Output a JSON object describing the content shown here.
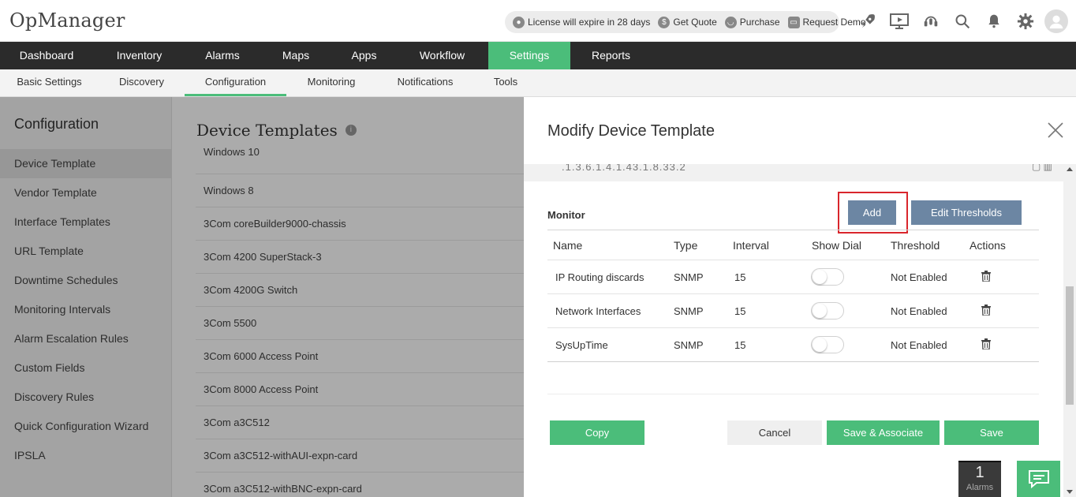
{
  "app": {
    "title": "OpManager"
  },
  "header": {
    "license_text": "License will expire in 28 days",
    "get_quote": "Get Quote",
    "purchase": "Purchase",
    "request_demo": "Request Demo",
    "icons": [
      "rocket-icon",
      "presentation-icon",
      "support-headset-icon",
      "search-icon",
      "bell-icon",
      "gear-icon",
      "user-avatar-icon"
    ]
  },
  "mainnav": {
    "items": [
      {
        "label": "Dashboard"
      },
      {
        "label": "Inventory"
      },
      {
        "label": "Alarms"
      },
      {
        "label": "Maps"
      },
      {
        "label": "Apps"
      },
      {
        "label": "Workflow"
      },
      {
        "label": "Settings"
      },
      {
        "label": "Reports"
      }
    ],
    "active": "Settings"
  },
  "subnav": {
    "items": [
      {
        "label": "Basic Settings"
      },
      {
        "label": "Discovery"
      },
      {
        "label": "Configuration"
      },
      {
        "label": "Monitoring"
      },
      {
        "label": "Notifications"
      },
      {
        "label": "Tools"
      }
    ],
    "active": "Configuration"
  },
  "sidebar": {
    "title": "Configuration",
    "items": [
      {
        "label": "Device Template"
      },
      {
        "label": "Vendor Template"
      },
      {
        "label": "Interface Templates"
      },
      {
        "label": "URL Template"
      },
      {
        "label": "Downtime Schedules"
      },
      {
        "label": "Monitoring Intervals"
      },
      {
        "label": "Alarm Escalation Rules"
      },
      {
        "label": "Custom Fields"
      },
      {
        "label": "Discovery Rules"
      },
      {
        "label": "Quick Configuration Wizard"
      },
      {
        "label": "IPSLA"
      }
    ],
    "active": "Device Template"
  },
  "content": {
    "title": "Device Templates",
    "templates": [
      "Windows 10",
      "Windows 8",
      "3Com coreBuilder9000-chassis",
      "3Com 4200 SuperStack-3",
      "3Com 4200G Switch",
      "3Com 5500",
      "3Com 6000 Access Point",
      "3Com 8000 Access Point",
      "3Com a3C512",
      "3Com a3C512-withAUI-expn-card",
      "3Com a3C512-withBNC-expn-card"
    ]
  },
  "modal": {
    "title": "Modify Device Template",
    "clipped_text": ".1.3.6.1.4.1.43.1.8.33.2",
    "monitor_label": "Monitor",
    "add_label": "Add",
    "edit_thresholds_label": "Edit Thresholds",
    "columns": [
      "Name",
      "Type",
      "Interval",
      "Show Dial",
      "Threshold",
      "Actions"
    ],
    "rows": [
      {
        "name": "IP Routing discards",
        "type": "SNMP",
        "interval": "15",
        "threshold": "Not Enabled",
        "show_dial": false
      },
      {
        "name": "Network Interfaces",
        "type": "SNMP",
        "interval": "15",
        "threshold": "Not Enabled",
        "show_dial": false
      },
      {
        "name": "SysUpTime",
        "type": "SNMP",
        "interval": "15",
        "threshold": "Not Enabled",
        "show_dial": false
      }
    ],
    "buttons": {
      "copy": "Copy",
      "cancel": "Cancel",
      "save_associate": "Save & Associate",
      "save": "Save"
    }
  },
  "footer": {
    "alarms_count": "1",
    "alarms_label": "Alarms"
  },
  "colors": {
    "accent_green": "#4bbd7a",
    "button_blue": "#6c86a3",
    "highlight_red": "#d9262c",
    "nav_dark": "#2b2b2b"
  }
}
